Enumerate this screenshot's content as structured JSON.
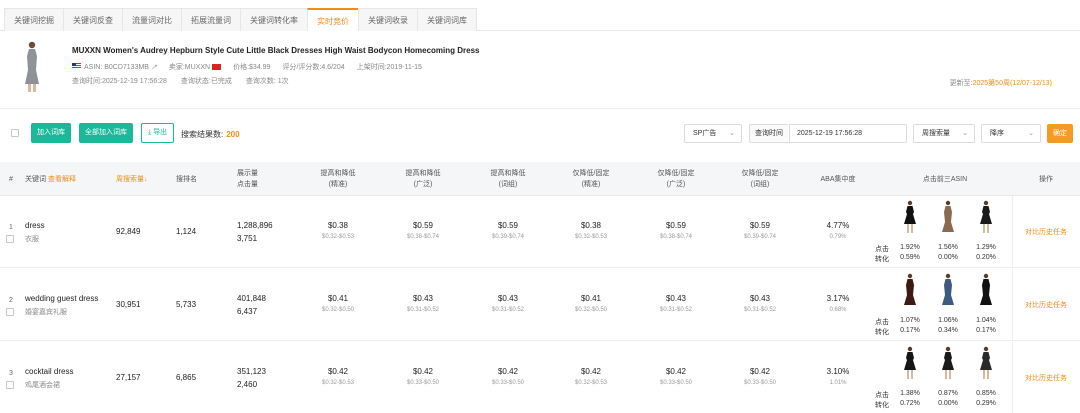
{
  "tabs": [
    "关键词挖掘",
    "关键词反查",
    "流量词对比",
    "拓展流量词",
    "关键词转化率",
    "实时竞价",
    "关键词收录",
    "关键词词库"
  ],
  "active_tab": 5,
  "product": {
    "title": "MUXXN Women's Audrey Hepburn Style Cute Little Black Dresses High Waist Bodycon Homecoming Dress",
    "asin": "ASIN: B0CD7133MB",
    "seller": "卖家:MUXXN",
    "price": "价格:$34.99",
    "rating": "评分/评分数:4.6/204",
    "listed": "上架时间:2019-11-15",
    "query_time": "查询时间:2025-12-19 17:56:28",
    "query_status": "查询状态:已完成",
    "query_count": "查询次数: 1次",
    "update_label": "更新至:",
    "update_value": "2025第50周(12/07-12/13)"
  },
  "toolbar": {
    "add_btn": "加入词库",
    "add_all_btn": "全部加入词库",
    "export_btn": "导出",
    "result_label": "搜索结果数:",
    "result_count": "200",
    "ad_type": "SP广告",
    "query_time_label": "查询时间",
    "query_time_value": "2025-12-19 17:56:28",
    "sort_field": "周搜索量",
    "sort_order": "降序",
    "confirm_btn": "确定"
  },
  "headers": {
    "idx": "#",
    "keyword": "关键词",
    "keyword_sub": "查看解释",
    "weekly": "周搜索量",
    "rank": "搜排名",
    "display": "展示量",
    "clicks": "点击量",
    "b1": "提高和降低",
    "b1s": "(精准)",
    "b2": "提高和降低",
    "b2s": "(广泛)",
    "b3": "提高和降低",
    "b3s": "(词组)",
    "f1": "仅降低/固定",
    "f1s": "(精准)",
    "f2": "仅降低/固定",
    "f2s": "(广泛)",
    "f3": "仅降低/固定",
    "f3s": "(词组)",
    "aba": "ABA集中度",
    "top3": "点击前三ASIN",
    "op": "操作"
  },
  "asin_labels": {
    "click": "点击",
    "conv": "转化"
  },
  "rows": [
    {
      "idx": "1",
      "keyword": "dress",
      "keyword_cn": "衣服",
      "weekly": "92,849",
      "rank": "1,124",
      "display": "1,288,896",
      "clicks": "3,751",
      "bids": [
        {
          "main": "$0.38",
          "range": "$0.32-$0.53"
        },
        {
          "main": "$0.59",
          "range": "$0.38-$0.74"
        },
        {
          "main": "$0.59",
          "range": "$0.39-$0.74"
        },
        {
          "main": "$0.38",
          "range": "$0.32-$0.53"
        },
        {
          "main": "$0.59",
          "range": "$0.38-$0.74"
        },
        {
          "main": "$0.59",
          "range": "$0.39-$0.74"
        }
      ],
      "aba": "4.77%",
      "aba_sub": "0.79%",
      "asins": [
        {
          "click": "1.92%",
          "conv": "0.59%",
          "color": "#111111",
          "style": "short"
        },
        {
          "click": "1.56%",
          "conv": "0.00%",
          "color": "#8a6a50",
          "style": "long"
        },
        {
          "click": "1.29%",
          "conv": "0.20%",
          "color": "#1a1a1a",
          "style": "short"
        }
      ],
      "op": "对比历史任务"
    },
    {
      "idx": "2",
      "keyword": "wedding guest dress",
      "keyword_cn": "婚宴嘉宾礼服",
      "weekly": "30,951",
      "rank": "5,733",
      "display": "401,848",
      "clicks": "6,437",
      "bids": [
        {
          "main": "$0.41",
          "range": "$0.32-$0.50"
        },
        {
          "main": "$0.43",
          "range": "$0.31-$0.52"
        },
        {
          "main": "$0.43",
          "range": "$0.31-$0.52"
        },
        {
          "main": "$0.41",
          "range": "$0.32-$0.50"
        },
        {
          "main": "$0.43",
          "range": "$0.31-$0.52"
        },
        {
          "main": "$0.43",
          "range": "$0.31-$0.52"
        }
      ],
      "aba": "3.17%",
      "aba_sub": "0.68%",
      "asins": [
        {
          "click": "1.07%",
          "conv": "0.17%",
          "color": "#3a1a12",
          "style": "long"
        },
        {
          "click": "1.06%",
          "conv": "0.34%",
          "color": "#3d5a80",
          "style": "long"
        },
        {
          "click": "1.04%",
          "conv": "0.17%",
          "color": "#111111",
          "style": "long"
        }
      ],
      "op": "对比历史任务"
    },
    {
      "idx": "3",
      "keyword": "cocktail dress",
      "keyword_cn": "鸡尾酒会裙",
      "weekly": "27,157",
      "rank": "6,865",
      "display": "351,123",
      "clicks": "2,460",
      "bids": [
        {
          "main": "$0.42",
          "range": "$0.32-$0.53"
        },
        {
          "main": "$0.42",
          "range": "$0.33-$0.50"
        },
        {
          "main": "$0.42",
          "range": "$0.33-$0.50"
        },
        {
          "main": "$0.42",
          "range": "$0.32-$0.53"
        },
        {
          "main": "$0.42",
          "range": "$0.33-$0.50"
        },
        {
          "main": "$0.42",
          "range": "$0.33-$0.50"
        }
      ],
      "aba": "3.10%",
      "aba_sub": "1.01%",
      "asins": [
        {
          "click": "1.38%",
          "conv": "0.72%",
          "color": "#151515",
          "style": "short"
        },
        {
          "click": "0.87%",
          "conv": "0.00%",
          "color": "#1a1a1a",
          "style": "short"
        },
        {
          "click": "0.85%",
          "conv": "0.29%",
          "color": "#2a2a2a",
          "style": "short"
        }
      ],
      "op": "对比历史任务"
    }
  ],
  "colors": {
    "accent": "#f08c1a",
    "green": "#1bb99a",
    "orange_btn": "#f59a23"
  }
}
